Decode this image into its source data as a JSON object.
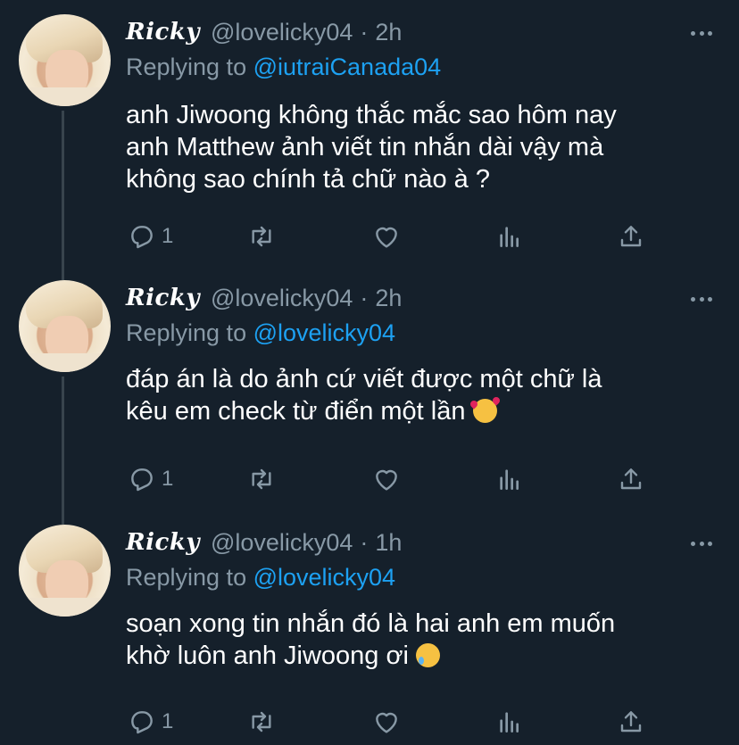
{
  "colors": {
    "background": "#15202b",
    "text": "#ffffff",
    "muted": "#8899a6",
    "link": "#1da1f2",
    "thread_line": "#38444d"
  },
  "tweets": [
    {
      "name": "Ricky",
      "handle": "@lovelicky04",
      "separator": "·",
      "time": "2h",
      "replying_label": "Replying to",
      "replying_to": "@iutraiCanada04",
      "lines": [
        "anh Jiwoong không thắc mắc sao hôm nay",
        "anh Matthew ảnh viết tin nhắn dài vậy mà",
        "không sao chính tả chữ nào à ?"
      ],
      "emoji": "",
      "reply_count": "1",
      "icons": [
        "reply-icon",
        "retweet-icon",
        "like-icon",
        "analytics-icon",
        "share-icon",
        "more-icon"
      ]
    },
    {
      "name": "Ricky",
      "handle": "@lovelicky04",
      "separator": "·",
      "time": "2h",
      "replying_label": "Replying to",
      "replying_to": "@lovelicky04",
      "lines": [
        "đáp án là do ảnh cứ viết được một chữ là",
        "kêu em check từ điển một lần"
      ],
      "emoji": "smiling-face-with-hearts",
      "reply_count": "1",
      "icons": [
        "reply-icon",
        "retweet-icon",
        "like-icon",
        "analytics-icon",
        "share-icon",
        "more-icon"
      ]
    },
    {
      "name": "Ricky",
      "handle": "@lovelicky04",
      "separator": "·",
      "time": "1h",
      "replying_label": "Replying to",
      "replying_to": "@lovelicky04",
      "lines": [
        "soạn xong tin nhắn đó là hai anh em muốn",
        "khờ luôn anh Jiwoong ơi"
      ],
      "emoji": "smiling-face-with-tear",
      "reply_count": "1",
      "icons": [
        "reply-icon",
        "retweet-icon",
        "like-icon",
        "analytics-icon",
        "share-icon",
        "more-icon"
      ]
    }
  ]
}
